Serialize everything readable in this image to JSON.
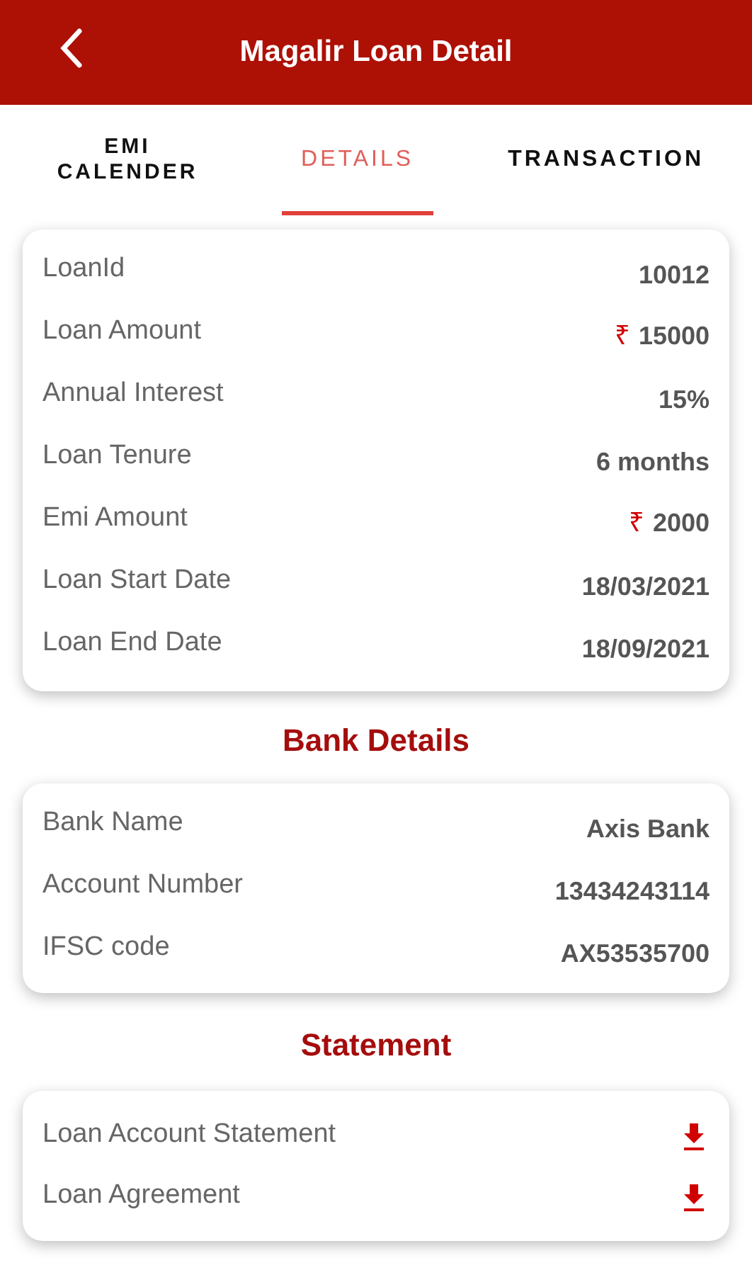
{
  "header": {
    "title": "Magalir Loan Detail"
  },
  "tabs": [
    {
      "label": "EMI CALENDER",
      "selected": false
    },
    {
      "label": "DETAILS",
      "selected": true
    },
    {
      "label": "TRANSACTION",
      "selected": false
    }
  ],
  "loan_details": [
    {
      "label": "LoanId",
      "value": "10012"
    },
    {
      "label": "Loan Amount",
      "currency": "₹",
      "value": "15000"
    },
    {
      "label": "Annual Interest",
      "value": "15%"
    },
    {
      "label": "Loan Tenure",
      "value": "6 months"
    },
    {
      "label": "Emi Amount",
      "currency": "₹",
      "value": "2000"
    },
    {
      "label": "Loan Start Date",
      "value": "18/03/2021"
    },
    {
      "label": "Loan End Date",
      "value": "18/09/2021"
    }
  ],
  "bank_details": {
    "title": "Bank Details",
    "rows": [
      {
        "label": "Bank Name",
        "value": "Axis Bank"
      },
      {
        "label": "Account Number",
        "value": "13434243114"
      },
      {
        "label": "IFSC code",
        "value": "AX53535700"
      }
    ]
  },
  "statement": {
    "title": "Statement",
    "items": [
      {
        "label": "Loan Account Statement"
      },
      {
        "label": "Loan Agreement"
      }
    ]
  }
}
